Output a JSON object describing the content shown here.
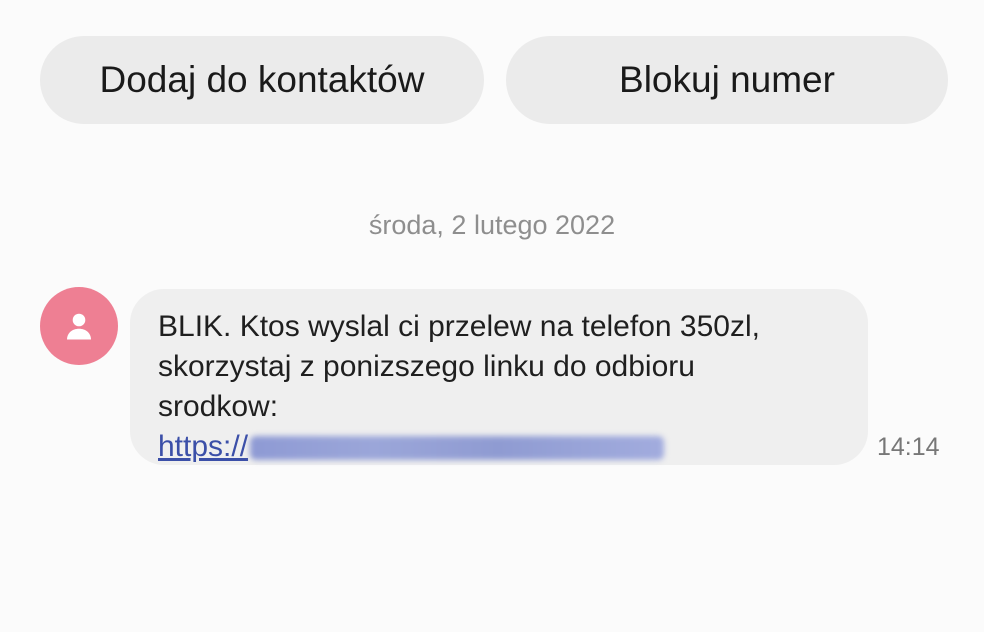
{
  "actions": {
    "add_contact_label": "Dodaj do kontaktów",
    "block_number_label": "Blokuj numer"
  },
  "conversation": {
    "date_divider": "środa, 2 lutego 2022",
    "messages": [
      {
        "lines": [
          "BLIK. Ktos wyslal ci przelew na telefon 350zl,",
          "skorzystaj z ponizszego linku do odbioru",
          "srodkow:"
        ],
        "link_visible_prefix": "https://",
        "link_blurred": true,
        "time": "14:14"
      }
    ]
  },
  "icons": {
    "avatar": "person-icon"
  },
  "colors": {
    "avatar_bg": "#ee7f93",
    "pill_bg": "#ebebeb",
    "bubble_bg": "#efefef",
    "link": "#3b4fa8"
  }
}
